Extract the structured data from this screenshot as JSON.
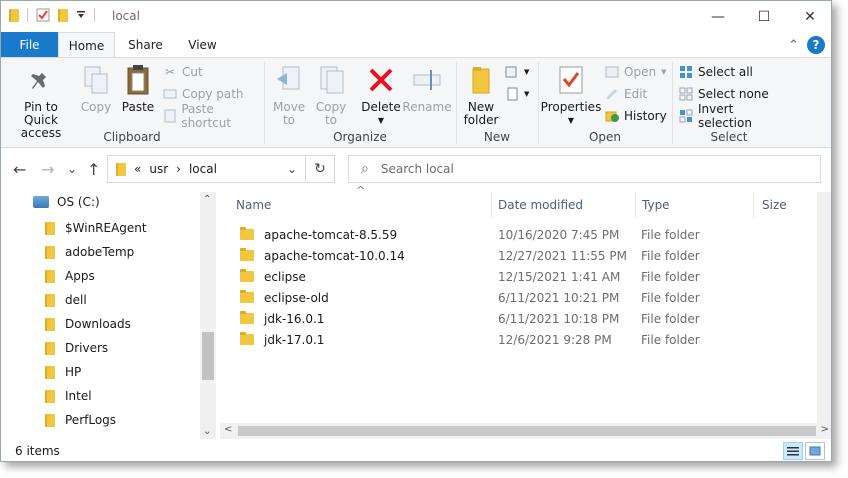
{
  "window": {
    "title": "local",
    "minimize_glyph": "—",
    "maximize_glyph": "☐",
    "close_glyph": "✕"
  },
  "ribbon_tabs": {
    "file": "File",
    "home": "Home",
    "share": "Share",
    "view": "View",
    "collapse_glyph": "⌃",
    "help_glyph": "?"
  },
  "clipboard": {
    "pin": "Pin to Quick access",
    "copy": "Copy",
    "paste": "Paste",
    "cut": "Cut",
    "copy_path": "Copy path",
    "paste_shortcut": "Paste shortcut",
    "label": "Clipboard"
  },
  "organize": {
    "move_to": "Move to",
    "copy_to": "Copy to",
    "delete": "Delete",
    "rename": "Rename",
    "label": "Organize"
  },
  "new_group": {
    "new_folder": "New folder",
    "label": "New"
  },
  "open_group": {
    "properties": "Properties",
    "open": "Open",
    "edit": "Edit",
    "history": "History",
    "label": "Open"
  },
  "select_group": {
    "select_all": "Select all",
    "select_none": "Select none",
    "invert": "Invert selection",
    "label": "Select"
  },
  "address": {
    "back": "←",
    "forward": "→",
    "recent": "⌄",
    "up": "↑",
    "chevrons": "«",
    "crumb_1": "usr",
    "crumb_sep": "›",
    "crumb_2": "local",
    "dropdown": "⌄",
    "refresh": "↻",
    "search_placeholder": "Search local",
    "search_glyph": "⌕"
  },
  "nav_pane": {
    "drive": "OS (C:)",
    "items": [
      "$WinREAgent",
      "adobeTemp",
      "Apps",
      "dell",
      "Downloads",
      "Drivers",
      "HP",
      "Intel",
      "PerfLogs"
    ],
    "scroll_up": "⌃",
    "scroll_down": "⌄"
  },
  "columns": {
    "name": "Name",
    "date": "Date modified",
    "type": "Type",
    "size": "Size",
    "sort_glyph": "^"
  },
  "files": [
    {
      "name": "apache-tomcat-8.5.59",
      "date": "10/16/2020 7:45 PM",
      "type": "File folder"
    },
    {
      "name": "apache-tomcat-10.0.14",
      "date": "12/27/2021 11:55 PM",
      "type": "File folder"
    },
    {
      "name": "eclipse",
      "date": "12/15/2021 1:41 AM",
      "type": "File folder"
    },
    {
      "name": "eclipse-old",
      "date": "6/11/2021 10:21 PM",
      "type": "File folder"
    },
    {
      "name": "jdk-16.0.1",
      "date": "6/11/2021 10:18 PM",
      "type": "File folder"
    },
    {
      "name": "jdk-17.0.1",
      "date": "12/6/2021 9:28 PM",
      "type": "File folder"
    }
  ],
  "status": {
    "count": "6 items",
    "scroll_left": "<",
    "scroll_right": ">"
  },
  "colors": {
    "accent": "#1979ca",
    "folder": "#f3c63f",
    "delete_red": "#e81123"
  }
}
